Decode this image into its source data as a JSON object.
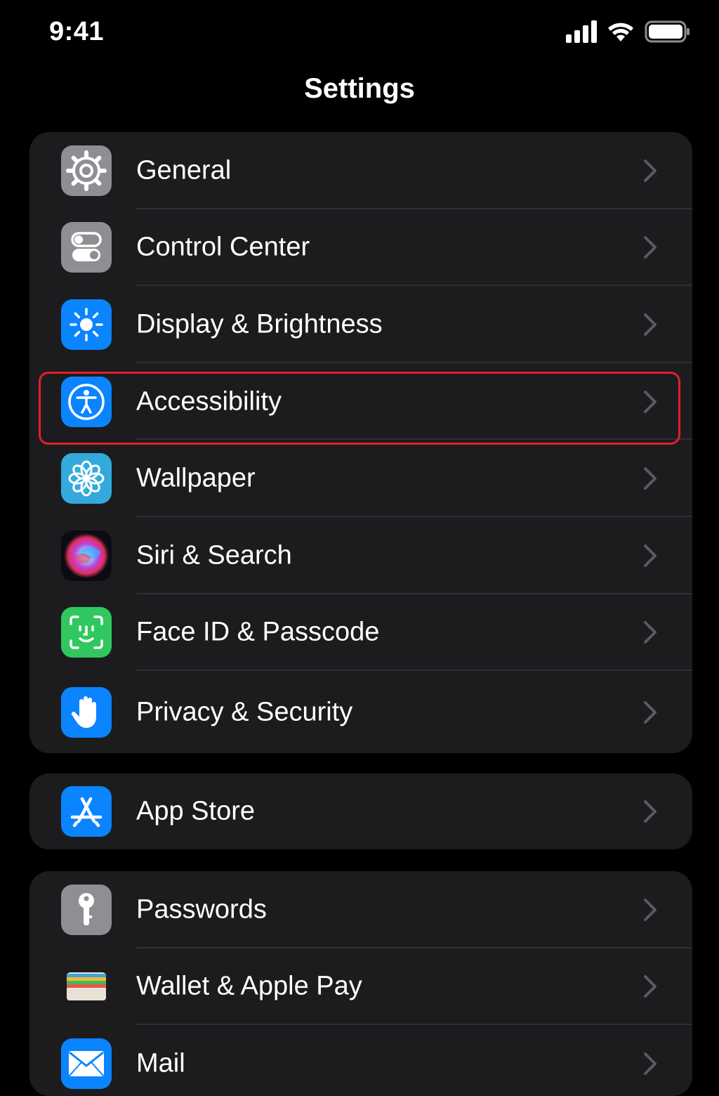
{
  "status_bar": {
    "time": "9:41"
  },
  "header": {
    "title": "Settings"
  },
  "groups": [
    {
      "items": [
        {
          "label": "General",
          "icon": "gear-icon",
          "color": "#8e8e93"
        },
        {
          "label": "Control Center",
          "icon": "toggles-icon",
          "color": "#8e8e93"
        },
        {
          "label": "Display & Brightness",
          "icon": "sun-icon",
          "color": "#0a84ff"
        },
        {
          "label": "Accessibility",
          "icon": "accessibility-icon",
          "color": "#0a84ff",
          "highlighted": true
        },
        {
          "label": "Wallpaper",
          "icon": "flower-icon",
          "color": "#34aadc"
        },
        {
          "label": "Siri & Search",
          "icon": "siri-icon",
          "color": "#1c1c2e"
        },
        {
          "label": "Face ID & Passcode",
          "icon": "face-id-icon",
          "color": "#30c85e"
        },
        {
          "label": "Privacy & Security",
          "icon": "hand-icon",
          "color": "#0a84ff"
        }
      ]
    },
    {
      "items": [
        {
          "label": "App Store",
          "icon": "app-store-icon",
          "color": "#0a84ff"
        }
      ]
    },
    {
      "items": [
        {
          "label": "Passwords",
          "icon": "key-icon",
          "color": "#8e8e93"
        },
        {
          "label": "Wallet & Apple Pay",
          "icon": "wallet-icon",
          "color": "#1c1c1e"
        },
        {
          "label": "Mail",
          "icon": "mail-icon",
          "color": "#0a84ff"
        }
      ]
    }
  ],
  "colors": {
    "background": "#000000",
    "group_background": "#1c1c1e",
    "highlight_border": "#e0202b",
    "chevron": "#5a5a5f"
  }
}
